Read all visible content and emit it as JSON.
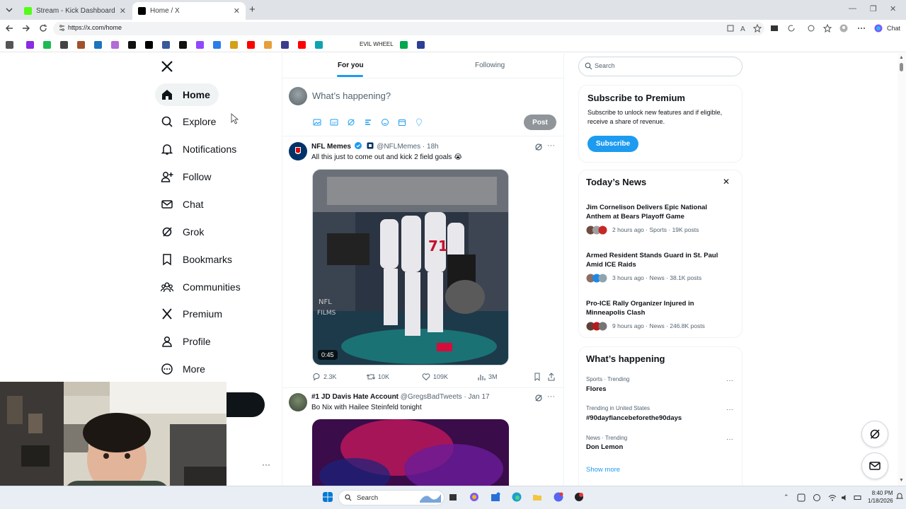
{
  "browser": {
    "tabs": [
      {
        "title": "Stream - Kick Dashboard",
        "favicon_color": "#53fc18"
      },
      {
        "title": "Home / X",
        "favicon_color": "#000000"
      }
    ],
    "url": "https://x.com/home",
    "bookmark_text": "EVIL WHEEL",
    "bookmark_colors": [
      "#555555",
      "#8a2be2",
      "#1db954",
      "#444444",
      "#a0522d",
      "#1e73be",
      "#b36bd6",
      "#111111",
      "#000000",
      "#3b5998",
      "#111111",
      "#9146ff",
      "#2b7de9",
      "#d4a017",
      "#ff0000",
      "#e5a03a",
      "#3c3c8c",
      "#ff0000",
      "#0fa3b1",
      "#00a651",
      "#2c3e99"
    ]
  },
  "sidebar": {
    "items": [
      {
        "label": "Home",
        "icon": "home-icon",
        "active": true
      },
      {
        "label": "Explore",
        "icon": "search-icon"
      },
      {
        "label": "Notifications",
        "icon": "bell-icon"
      },
      {
        "label": "Follow",
        "icon": "add-person-icon"
      },
      {
        "label": "Chat",
        "icon": "mail-icon"
      },
      {
        "label": "Grok",
        "icon": "grok-icon"
      },
      {
        "label": "Bookmarks",
        "icon": "bookmark-icon"
      },
      {
        "label": "Communities",
        "icon": "communities-icon"
      },
      {
        "label": "Premium",
        "icon": "x-icon"
      },
      {
        "label": "Profile",
        "icon": "person-icon"
      },
      {
        "label": "More",
        "icon": "more-circle-icon"
      }
    ],
    "account_more": "···"
  },
  "feed": {
    "tabs": [
      "For you",
      "Following"
    ],
    "compose_placeholder": "What’s happening?",
    "post_label": "Post",
    "tweets": [
      {
        "name": "NFL Memes",
        "handle": "@NFLMemes",
        "time": "· 18h",
        "text": "All this just to come out and kick 2 field goals 😭",
        "duration": "0:45",
        "replies": "2.3K",
        "reposts": "10K",
        "likes": "109K",
        "views": "3M"
      },
      {
        "name": "#1 JD Davis Hate Account",
        "handle": "@GregsBadTweets",
        "time": "· Jan 17",
        "text": "Bo Nix with Hailee Steinfeld tonight"
      }
    ]
  },
  "right": {
    "search_placeholder": "Search",
    "premium": {
      "title": "Subscribe to Premium",
      "body": "Subscribe to unlock new features and if eligible, receive a share of revenue.",
      "button": "Subscribe"
    },
    "news": {
      "title": "Today’s News",
      "close": "✕",
      "items": [
        {
          "title": "Jim Cornelison Delivers Epic National Anthem at Bears Playoff Game",
          "meta": "2 hours ago · Sports · 19K posts"
        },
        {
          "title": "Armed Resident Stands Guard in St. Paul Amid ICE Raids",
          "meta": "3 hours ago · News · 38.1K posts"
        },
        {
          "title": "Pro-ICE Rally Organizer Injured in Minneapolis Clash",
          "meta": "9 hours ago · News · 246.8K posts"
        }
      ]
    },
    "happening": {
      "title": "What’s happening",
      "items": [
        {
          "meta": "Sports · Trending",
          "title": "Flores"
        },
        {
          "meta": "Trending in United States",
          "title": "#90dayfiancebeforethe90days"
        },
        {
          "meta": "News · Trending",
          "title": "Don Lemon"
        }
      ],
      "show_more": "Show more"
    }
  },
  "taskbar": {
    "search_label": "Search",
    "time": "8:40 PM",
    "date": "1/18/2026"
  }
}
